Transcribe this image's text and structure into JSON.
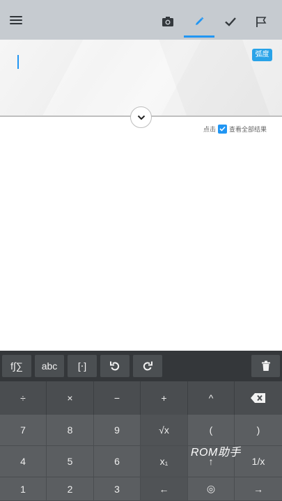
{
  "toolbar": {
    "icons": [
      "menu-icon",
      "camera-icon",
      "pencil-icon",
      "check-icon",
      "flag-icon"
    ],
    "accent": "#2196f3"
  },
  "input": {
    "angle_mode": "弧度"
  },
  "results": {
    "hint_prefix": "点击",
    "hint_suffix": "查看全部结果"
  },
  "keyboard": {
    "function_row": {
      "func": "f∫∑",
      "abc": "abc",
      "matrix": "[⋅]"
    },
    "operators": [
      "÷",
      "×",
      "−",
      "+",
      "^"
    ],
    "grid": {
      "row1": [
        "7",
        "8",
        "9",
        "√x",
        "(",
        ")"
      ],
      "row2": [
        "4",
        "5",
        "6",
        "x₁",
        "↑",
        "1/x"
      ],
      "row3": [
        "1",
        "2",
        "3",
        "←",
        "◎",
        "→"
      ]
    }
  },
  "watermark": "ROM助手"
}
